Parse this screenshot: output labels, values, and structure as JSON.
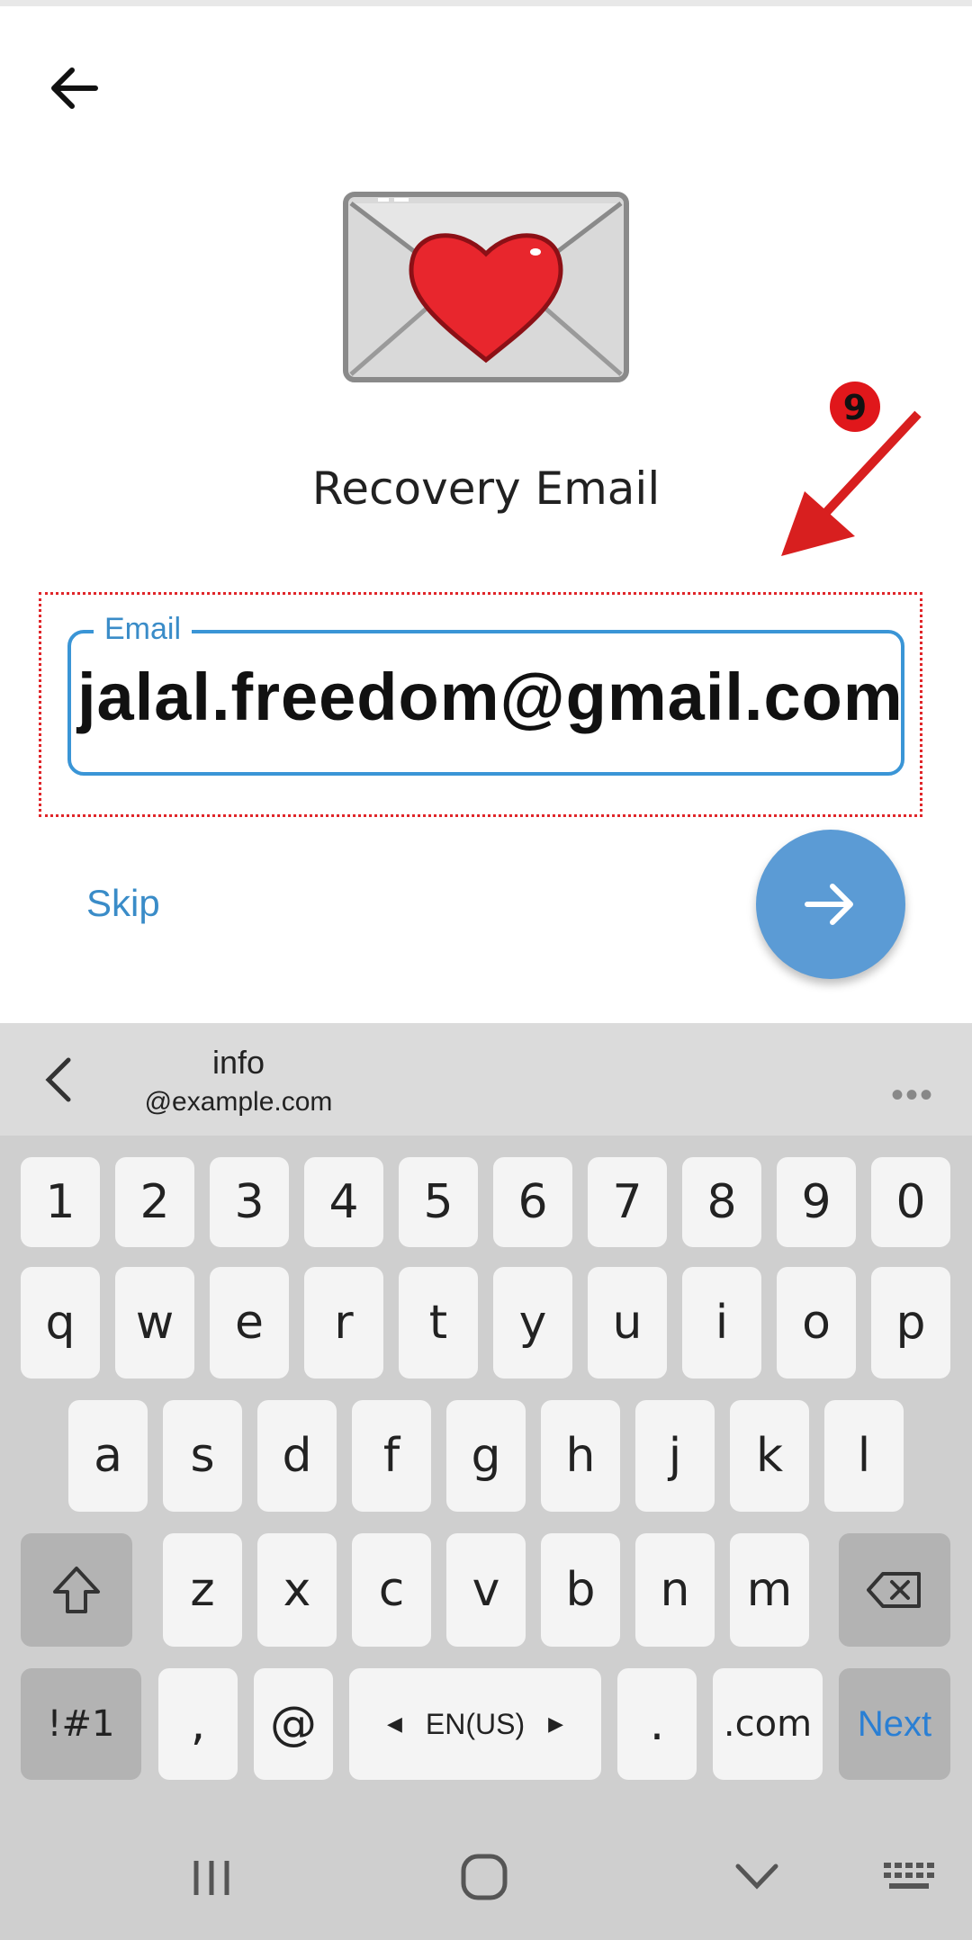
{
  "screen": {
    "title": "Recovery Email",
    "annotation_badge": "9"
  },
  "email_field": {
    "label": "Email",
    "value": "jalal.freedom@gmail.com"
  },
  "actions": {
    "skip_label": "Skip"
  },
  "suggestion_bar": {
    "main": "info",
    "sub": "@example.com"
  },
  "keyboard": {
    "row_numbers": [
      "1",
      "2",
      "3",
      "4",
      "5",
      "6",
      "7",
      "8",
      "9",
      "0"
    ],
    "row1": [
      "q",
      "w",
      "e",
      "r",
      "t",
      "y",
      "u",
      "i",
      "o",
      "p"
    ],
    "row2": [
      "a",
      "s",
      "d",
      "f",
      "g",
      "h",
      "j",
      "k",
      "l"
    ],
    "row3": [
      "z",
      "x",
      "c",
      "v",
      "b",
      "n",
      "m"
    ],
    "symbols_label": "!#1",
    "comma_label": ",",
    "at_label": "@",
    "space_label": "EN(US)",
    "period_label": ".",
    "dotcom_label": ".com",
    "next_label": "Next"
  },
  "colors": {
    "accent": "#3a8cc8",
    "fab": "#5b9bd5",
    "annotation": "#e0262a"
  }
}
